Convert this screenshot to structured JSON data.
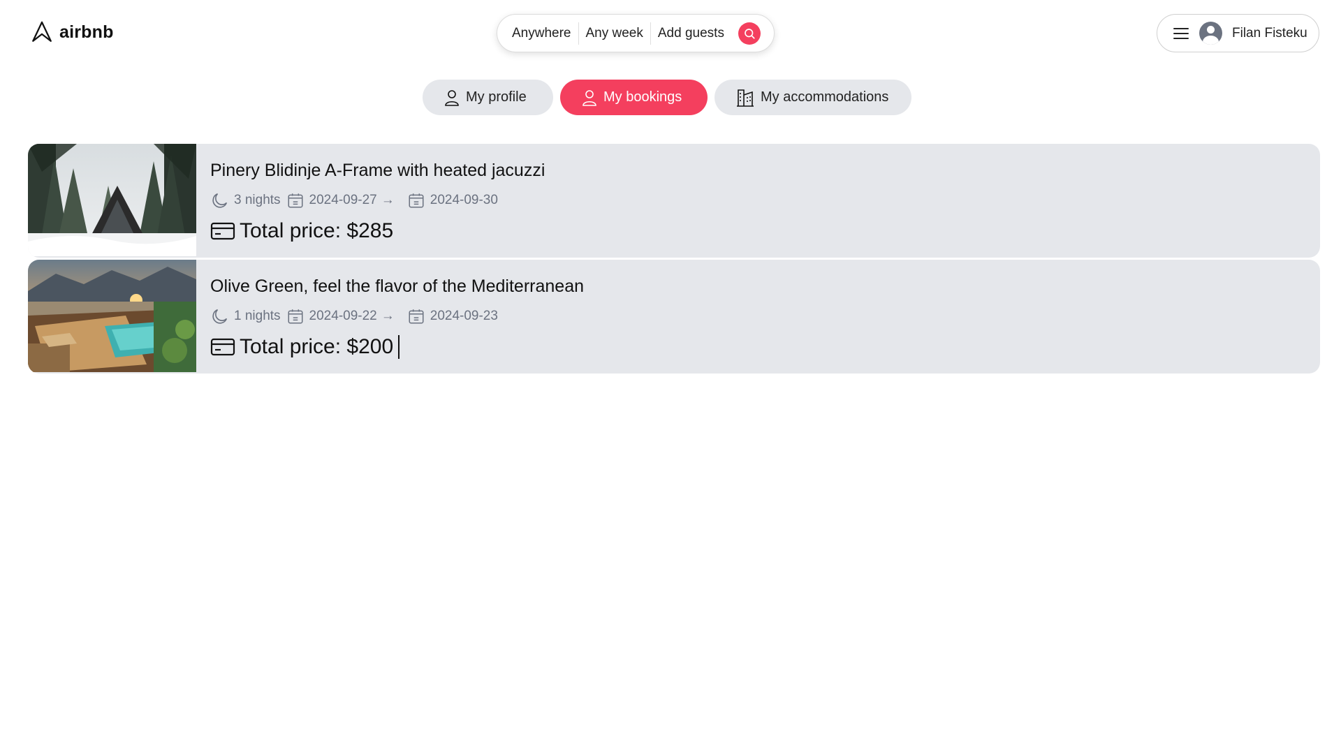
{
  "header": {
    "logo_text": "airbnb",
    "search": {
      "location": "Anywhere",
      "week": "Any week",
      "guests": "Add guests"
    },
    "user": {
      "name": "Filan Fisteku"
    }
  },
  "tabs": [
    {
      "label": "My profile",
      "icon": "user-icon",
      "active": false
    },
    {
      "label": "My bookings",
      "icon": "user-icon",
      "active": true
    },
    {
      "label": "My accommodations",
      "icon": "building-icon",
      "active": false
    }
  ],
  "bookings": [
    {
      "title": "Pinery Blidinje A-Frame with heated jacuzzi",
      "nights": "3 nights",
      "check_in": "2024-09-27",
      "check_out": "2024-09-30",
      "price": "Total price: $285"
    },
    {
      "title": "Olive Green, feel the flavor of the Mediterranean",
      "nights": "1 nights",
      "check_in": "2024-09-22",
      "check_out": "2024-09-23",
      "price": "Total price: $200"
    }
  ],
  "colors": {
    "accent": "#f43f5e",
    "card_bg": "#e5e7eb",
    "muted_text": "#6b7280"
  }
}
